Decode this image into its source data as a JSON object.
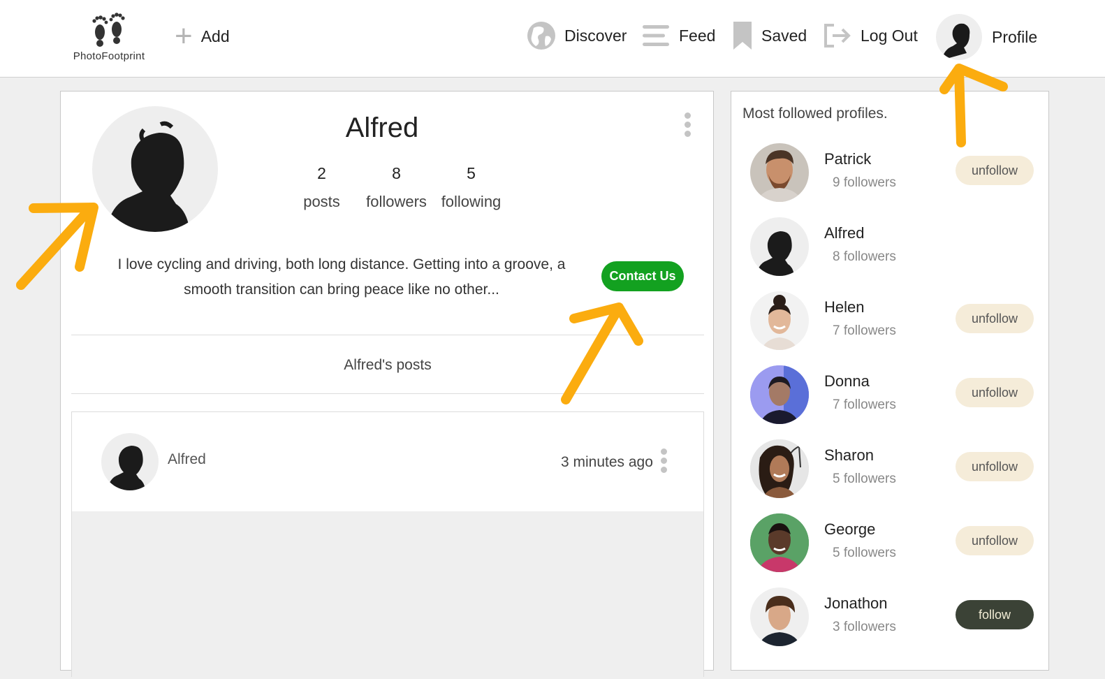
{
  "nav": {
    "logo_text": "PhotoFootprint",
    "add": "Add",
    "discover": "Discover",
    "feed": "Feed",
    "saved": "Saved",
    "logout": "Log Out",
    "profile": "Profile"
  },
  "profile": {
    "name": "Alfred",
    "stats": [
      {
        "value": "2",
        "label": "posts"
      },
      {
        "value": "8",
        "label": "followers"
      },
      {
        "value": "5",
        "label": "following"
      }
    ],
    "bio": "I love cycling and driving, both long distance. Getting into a groove, a smooth transition can bring peace like no other...",
    "contact_label": "Contact Us",
    "posts_heading": "Alfred's posts"
  },
  "post": {
    "author": "Alfred",
    "time": "3 minutes ago"
  },
  "sidebar": {
    "title": "Most followed profiles.",
    "profiles": [
      {
        "name": "Patrick",
        "followers": "9 followers",
        "button": "unfollow"
      },
      {
        "name": "Alfred",
        "followers": "8 followers",
        "button": ""
      },
      {
        "name": "Helen",
        "followers": "7 followers",
        "button": "unfollow"
      },
      {
        "name": "Donna",
        "followers": "7 followers",
        "button": "unfollow"
      },
      {
        "name": "Sharon",
        "followers": "5 followers",
        "button": "unfollow"
      },
      {
        "name": "George",
        "followers": "5 followers",
        "button": "unfollow"
      },
      {
        "name": "Jonathon",
        "followers": "3 followers",
        "button": "follow"
      }
    ]
  },
  "colors": {
    "contact_button": "#13a120",
    "unfollow_button": "#f5ecd9",
    "follow_button": "#3b4236",
    "annotation_arrow": "#fbac0f"
  }
}
